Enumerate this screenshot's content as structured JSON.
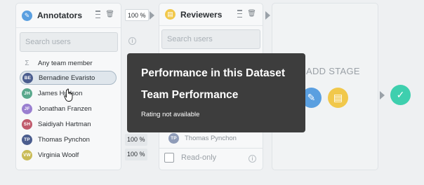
{
  "annotators": {
    "title": "Annotators",
    "search_placeholder": "Search users",
    "any_member": "Any team member",
    "users": [
      {
        "initials": "BE",
        "name": "Bernadine Evaristo",
        "color": "#4b5d8e",
        "selected": true
      },
      {
        "initials": "JH",
        "name": "James Hudson",
        "color": "#5aa88c"
      },
      {
        "initials": "JF",
        "name": "Jonathan Franzen",
        "color": "#9a7fd0"
      },
      {
        "initials": "SH",
        "name": "Saidiyah Hartman",
        "color": "#c05a6c"
      },
      {
        "initials": "TP",
        "name": "Thomas Pynchon",
        "color": "#4b5d8e"
      },
      {
        "initials": "VW",
        "name": "Virginia Woolf",
        "color": "#c9bb56"
      }
    ]
  },
  "percentages": {
    "top": "100 %",
    "rows": [
      "100 %",
      "100 %"
    ]
  },
  "reviewers": {
    "title": "Reviewers",
    "search_placeholder": "Search users",
    "visible_user": {
      "initials": "TP",
      "name": "Thomas Pynchon",
      "color": "#8f9cb8"
    },
    "readonly_label": "Read-only"
  },
  "tooltip": {
    "heading1": "Performance in this Dataset",
    "heading2": "Team Performance",
    "note": "Rating not available"
  },
  "add_stage": {
    "label": "ADD STAGE"
  },
  "colors": {
    "annotate_blue": "#5a9fe0",
    "review_yellow": "#f1c84b",
    "complete_green": "#3ecfae",
    "tooltip_bg": "#3d3d3d"
  },
  "icons": {
    "annotators_icon": "pencil-icon",
    "reviewers_icon": "clipboard-icon",
    "complete_icon": "check-icon"
  }
}
